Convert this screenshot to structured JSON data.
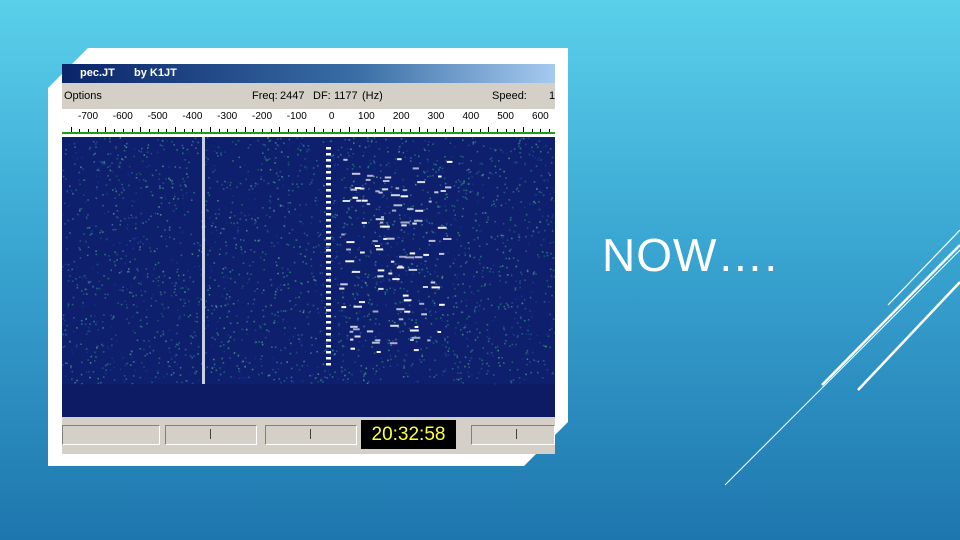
{
  "slide": {
    "title": "NOW….",
    "background_top": "#5ad0ea",
    "background_bottom": "#1e76ae"
  },
  "window": {
    "app_title": "pec.JT",
    "by_label": "by K1JT",
    "menu_options": "Options",
    "freq_label": "Freq:",
    "freq_value": "2447",
    "df_label": "DF:",
    "df_value": "1177",
    "df_unit": "(Hz)",
    "speed_label": "Speed:",
    "speed_value": "1"
  },
  "ruler": {
    "labels": [
      "-700",
      "-600",
      "-500",
      "-400",
      "-300",
      "-200",
      "-100",
      "0",
      "100",
      "200",
      "300",
      "400",
      "500",
      "600"
    ],
    "bar_color": "#1c9e1c"
  },
  "spectrogram": {
    "background_color": "#0e1f6e"
  },
  "status": {
    "time": "20:32:58",
    "time_color": "#ffff40"
  }
}
